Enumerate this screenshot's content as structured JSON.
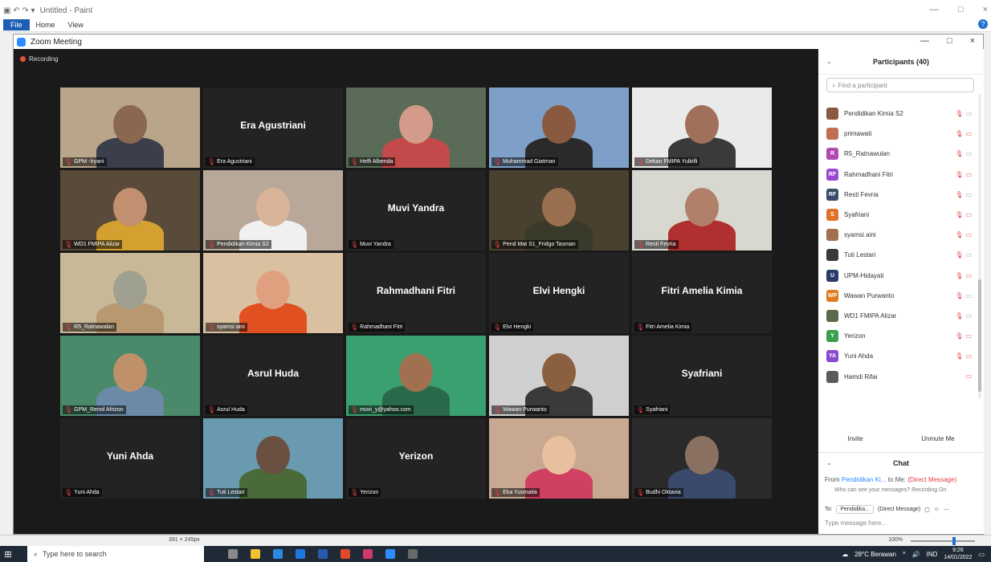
{
  "paint": {
    "title": "Untitled - Paint",
    "tabs": [
      "File",
      "Home",
      "View"
    ],
    "window_controls": [
      "—",
      "□",
      "×"
    ],
    "help": "?"
  },
  "zoom": {
    "title": "Zoom Meeting",
    "window_controls": [
      "—",
      "□",
      "×"
    ],
    "recording": "Recording",
    "tiles": [
      {
        "label": "GPM -Iryani",
        "kind": "video",
        "bg": "#b9a58a",
        "skin": "#8a6850",
        "cloth": "#3b3f4b"
      },
      {
        "label": "Era Agustriani",
        "kind": "name",
        "center": "Era Agustriani"
      },
      {
        "label": "Helfi Albenda",
        "kind": "video",
        "bg": "#5a6b58",
        "skin": "#d49a8a",
        "cloth": "#c24a4a"
      },
      {
        "label": "Muhammad Giatman",
        "kind": "video",
        "bg": "#7ea0c8",
        "skin": "#8a5a40",
        "cloth": "#2a2a2a",
        "active": true
      },
      {
        "label": "Dekan FMIPA Yulkifli",
        "kind": "video",
        "bg": "#eaeaea",
        "skin": "#a0705a",
        "cloth": "#3a3a3a"
      },
      {
        "label": "WD1 FMIPA Alizar",
        "kind": "video",
        "bg": "#5a4a3a",
        "skin": "#c29070",
        "cloth": "#d4a030"
      },
      {
        "label": "Pendidikan Kimia S2",
        "kind": "video",
        "bg": "#b8a89a",
        "skin": "#d9b49a",
        "cloth": "#f0f0f0"
      },
      {
        "label": "Muvi Yandra",
        "kind": "name",
        "center": "Muvi Yandra"
      },
      {
        "label": "Pend Mat S1_Fridgo Tasman",
        "kind": "video",
        "bg": "#4a4030",
        "skin": "#9a7050",
        "cloth": "#3a3a2a"
      },
      {
        "label": "Resti Fevria",
        "kind": "video",
        "bg": "#d8d8d0",
        "skin": "#b08068",
        "cloth": "#b03030"
      },
      {
        "label": "R5_Ratnawalan",
        "kind": "video",
        "bg": "#c8b898",
        "skin": "#a0a090",
        "cloth": "#b89870"
      },
      {
        "label": "syamsi aini",
        "kind": "video",
        "bg": "#d8c0a0",
        "skin": "#e0a080",
        "cloth": "#e05020"
      },
      {
        "label": "Rahmadhani Fitri",
        "kind": "name",
        "center": "Rahmadhani Fitri"
      },
      {
        "label": "Elvi Hengki",
        "kind": "name",
        "center": "Elvi Hengki"
      },
      {
        "label": "Fitri Amelia Kimia",
        "kind": "name",
        "center": "Fitri Amelia Kimia"
      },
      {
        "label": "GPM_Renol Afrizon",
        "kind": "video",
        "bg": "#4a8a6a",
        "skin": "#c0906a",
        "cloth": "#6a8aa8"
      },
      {
        "label": "Asrul Huda",
        "kind": "name",
        "center": "Asrul Huda"
      },
      {
        "label": "muvi_y@yahoo.com",
        "kind": "video",
        "bg": "#3aa070",
        "skin": "#a07050",
        "cloth": "#2a6a4a"
      },
      {
        "label": "Wawan Purwanto",
        "kind": "video",
        "bg": "#d0d0d0",
        "skin": "#8a6040",
        "cloth": "#3a3a3a"
      },
      {
        "label": "Syafriani",
        "kind": "name",
        "center": "Syafriani"
      },
      {
        "label": "Yuni Ahda",
        "kind": "name",
        "center": "Yuni Ahda"
      },
      {
        "label": "Tuti Lestari",
        "kind": "video",
        "bg": "#6a9ab0",
        "skin": "#6a5040",
        "cloth": "#4a6a3a"
      },
      {
        "label": "Yerizon",
        "kind": "name",
        "center": "Yerizon"
      },
      {
        "label": "Eka Yusmaita",
        "kind": "video",
        "bg": "#c8a890",
        "skin": "#e8c0a0",
        "cloth": "#d04060"
      },
      {
        "label": "Budhi Oktavia",
        "kind": "video",
        "bg": "#2a2a2a",
        "skin": "#8a7060",
        "cloth": "#3a4a6a"
      }
    ]
  },
  "participants": {
    "header": "Participants (40)",
    "search_placeholder": "Find a participant",
    "items": [
      {
        "name": "Pendidikan Kimia S2",
        "avatar": "",
        "color": "#8a5a40",
        "video_on": true
      },
      {
        "name": "primawati",
        "avatar": "",
        "color": "#c07050",
        "video_on": false
      },
      {
        "name": "R5_Ratnawulan",
        "avatar": "R",
        "color": "#b04ab0",
        "video_on": true
      },
      {
        "name": "Rahmadhani Fitri",
        "avatar": "RF",
        "color": "#9a4ad0",
        "video_on": false
      },
      {
        "name": "Resti Fevria",
        "avatar": "RF",
        "color": "#3a4a6a",
        "video_on": true
      },
      {
        "name": "Syafriani",
        "avatar": "S",
        "color": "#e0702a",
        "video_on": false
      },
      {
        "name": "syamsi aini",
        "avatar": "",
        "color": "#a07050",
        "video_on": false
      },
      {
        "name": "Tuti Lestari",
        "avatar": "",
        "color": "#3a3a3a",
        "video_on": true
      },
      {
        "name": "UPM-Hidayati",
        "avatar": "U",
        "color": "#2a3a6a",
        "video_on": false
      },
      {
        "name": "Wawan Purwanto",
        "avatar": "WP",
        "color": "#e07a20",
        "video_on": true
      },
      {
        "name": "WD1 FMIPA Alizar",
        "avatar": "",
        "color": "#5a6a4a",
        "video_on": true
      },
      {
        "name": "Yerizon",
        "avatar": "Y",
        "color": "#3aa050",
        "video_on": false
      },
      {
        "name": "Yuni Ahda",
        "avatar": "YA",
        "color": "#8a4ad0",
        "video_on": false
      },
      {
        "name": "Hamdi Rifai",
        "avatar": "",
        "color": "#5a5a5a",
        "video_on": false,
        "unmuted": true
      }
    ],
    "invite": "Invite",
    "unmute_me": "Unmute Me"
  },
  "chat": {
    "header": "Chat",
    "from_prefix": "From",
    "from_name": "Pendidikan Ki...",
    "to_me": "to Me:",
    "direct": "(Direct Message)",
    "note": "Who can see your messages? Recording On",
    "to_label": "To:",
    "to_select": "Pendidika...",
    "to_direct": "(Direct Message)",
    "input_placeholder": "Type message here..."
  },
  "status": {
    "dimensions": "391 × 245px",
    "zoom": "100%"
  },
  "taskbar": {
    "search_placeholder": "Type here to search",
    "weather": "28°C Berawan",
    "lang": "IND",
    "time": "9:26",
    "date": "14/01/2022"
  }
}
